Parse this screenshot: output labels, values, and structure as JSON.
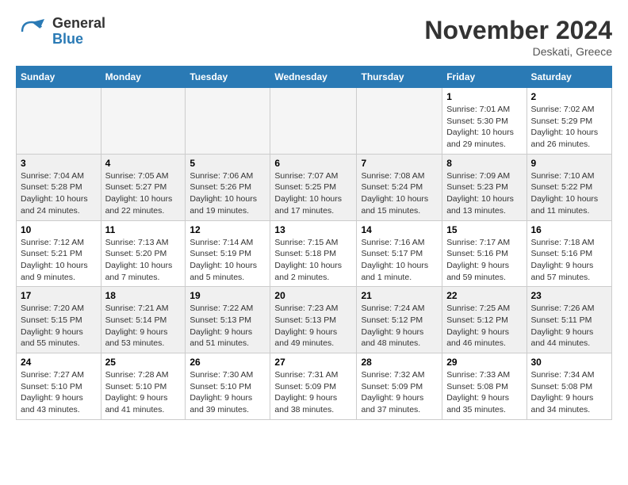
{
  "header": {
    "logo_general": "General",
    "logo_blue": "Blue",
    "month": "November 2024",
    "location": "Deskati, Greece"
  },
  "weekdays": [
    "Sunday",
    "Monday",
    "Tuesday",
    "Wednesday",
    "Thursday",
    "Friday",
    "Saturday"
  ],
  "weeks": [
    [
      {
        "day": "",
        "info": ""
      },
      {
        "day": "",
        "info": ""
      },
      {
        "day": "",
        "info": ""
      },
      {
        "day": "",
        "info": ""
      },
      {
        "day": "",
        "info": ""
      },
      {
        "day": "1",
        "info": "Sunrise: 7:01 AM\nSunset: 5:30 PM\nDaylight: 10 hours and 29 minutes."
      },
      {
        "day": "2",
        "info": "Sunrise: 7:02 AM\nSunset: 5:29 PM\nDaylight: 10 hours and 26 minutes."
      }
    ],
    [
      {
        "day": "3",
        "info": "Sunrise: 7:04 AM\nSunset: 5:28 PM\nDaylight: 10 hours and 24 minutes."
      },
      {
        "day": "4",
        "info": "Sunrise: 7:05 AM\nSunset: 5:27 PM\nDaylight: 10 hours and 22 minutes."
      },
      {
        "day": "5",
        "info": "Sunrise: 7:06 AM\nSunset: 5:26 PM\nDaylight: 10 hours and 19 minutes."
      },
      {
        "day": "6",
        "info": "Sunrise: 7:07 AM\nSunset: 5:25 PM\nDaylight: 10 hours and 17 minutes."
      },
      {
        "day": "7",
        "info": "Sunrise: 7:08 AM\nSunset: 5:24 PM\nDaylight: 10 hours and 15 minutes."
      },
      {
        "day": "8",
        "info": "Sunrise: 7:09 AM\nSunset: 5:23 PM\nDaylight: 10 hours and 13 minutes."
      },
      {
        "day": "9",
        "info": "Sunrise: 7:10 AM\nSunset: 5:22 PM\nDaylight: 10 hours and 11 minutes."
      }
    ],
    [
      {
        "day": "10",
        "info": "Sunrise: 7:12 AM\nSunset: 5:21 PM\nDaylight: 10 hours and 9 minutes."
      },
      {
        "day": "11",
        "info": "Sunrise: 7:13 AM\nSunset: 5:20 PM\nDaylight: 10 hours and 7 minutes."
      },
      {
        "day": "12",
        "info": "Sunrise: 7:14 AM\nSunset: 5:19 PM\nDaylight: 10 hours and 5 minutes."
      },
      {
        "day": "13",
        "info": "Sunrise: 7:15 AM\nSunset: 5:18 PM\nDaylight: 10 hours and 2 minutes."
      },
      {
        "day": "14",
        "info": "Sunrise: 7:16 AM\nSunset: 5:17 PM\nDaylight: 10 hours and 1 minute."
      },
      {
        "day": "15",
        "info": "Sunrise: 7:17 AM\nSunset: 5:16 PM\nDaylight: 9 hours and 59 minutes."
      },
      {
        "day": "16",
        "info": "Sunrise: 7:18 AM\nSunset: 5:16 PM\nDaylight: 9 hours and 57 minutes."
      }
    ],
    [
      {
        "day": "17",
        "info": "Sunrise: 7:20 AM\nSunset: 5:15 PM\nDaylight: 9 hours and 55 minutes."
      },
      {
        "day": "18",
        "info": "Sunrise: 7:21 AM\nSunset: 5:14 PM\nDaylight: 9 hours and 53 minutes."
      },
      {
        "day": "19",
        "info": "Sunrise: 7:22 AM\nSunset: 5:13 PM\nDaylight: 9 hours and 51 minutes."
      },
      {
        "day": "20",
        "info": "Sunrise: 7:23 AM\nSunset: 5:13 PM\nDaylight: 9 hours and 49 minutes."
      },
      {
        "day": "21",
        "info": "Sunrise: 7:24 AM\nSunset: 5:12 PM\nDaylight: 9 hours and 48 minutes."
      },
      {
        "day": "22",
        "info": "Sunrise: 7:25 AM\nSunset: 5:12 PM\nDaylight: 9 hours and 46 minutes."
      },
      {
        "day": "23",
        "info": "Sunrise: 7:26 AM\nSunset: 5:11 PM\nDaylight: 9 hours and 44 minutes."
      }
    ],
    [
      {
        "day": "24",
        "info": "Sunrise: 7:27 AM\nSunset: 5:10 PM\nDaylight: 9 hours and 43 minutes."
      },
      {
        "day": "25",
        "info": "Sunrise: 7:28 AM\nSunset: 5:10 PM\nDaylight: 9 hours and 41 minutes."
      },
      {
        "day": "26",
        "info": "Sunrise: 7:30 AM\nSunset: 5:10 PM\nDaylight: 9 hours and 39 minutes."
      },
      {
        "day": "27",
        "info": "Sunrise: 7:31 AM\nSunset: 5:09 PM\nDaylight: 9 hours and 38 minutes."
      },
      {
        "day": "28",
        "info": "Sunrise: 7:32 AM\nSunset: 5:09 PM\nDaylight: 9 hours and 37 minutes."
      },
      {
        "day": "29",
        "info": "Sunrise: 7:33 AM\nSunset: 5:08 PM\nDaylight: 9 hours and 35 minutes."
      },
      {
        "day": "30",
        "info": "Sunrise: 7:34 AM\nSunset: 5:08 PM\nDaylight: 9 hours and 34 minutes."
      }
    ]
  ]
}
